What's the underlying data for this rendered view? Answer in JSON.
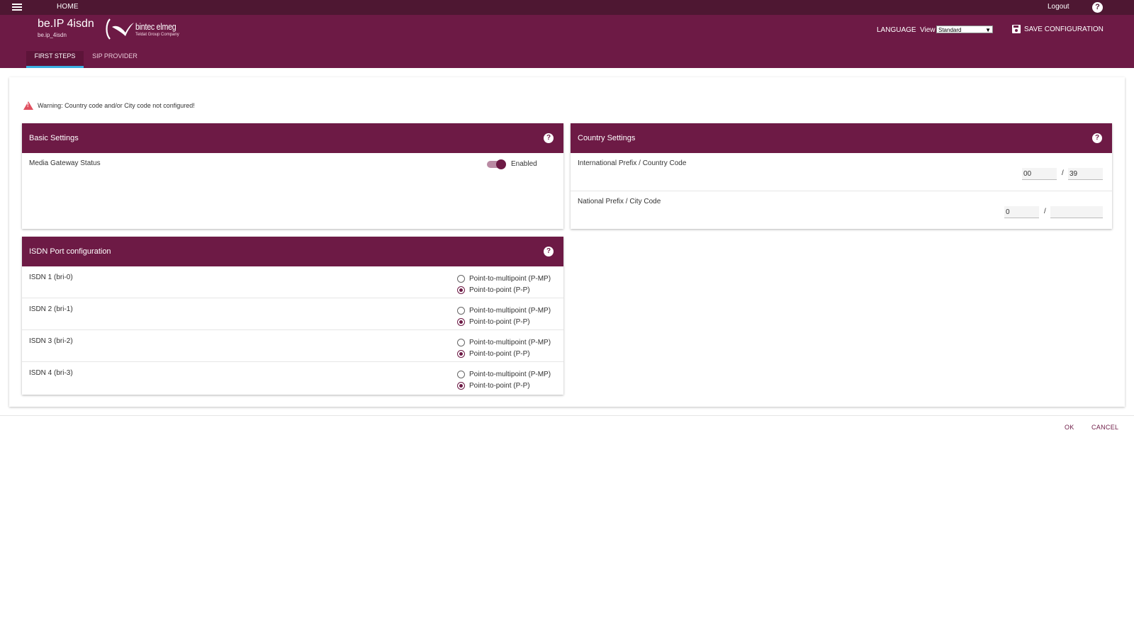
{
  "topbar": {
    "home": "HOME",
    "logout": "Logout",
    "help": "?"
  },
  "header": {
    "device_name": "be.IP 4isdn",
    "device_host": "be.ip_4isdn",
    "logo_brand": "bintec elmeg",
    "logo_sub": "Teldat Group Company",
    "language": "LANGUAGE",
    "view_label": "View",
    "view_value": "Standard",
    "save_config": "SAVE CONFIGURATION"
  },
  "tabs": [
    {
      "label": "FIRST STEPS",
      "active": true
    },
    {
      "label": "SIP PROVIDER",
      "active": false
    }
  ],
  "warning": "Warning: Country code and/or City code not configured!",
  "basic": {
    "title": "Basic Settings",
    "media_gateway_label": "Media Gateway Status",
    "media_gateway_state": "Enabled"
  },
  "country": {
    "title": "Country Settings",
    "intl_label": "International Prefix / Country Code",
    "intl_prefix": "00",
    "country_code": "39",
    "national_label": "National Prefix / City Code",
    "national_prefix": "0",
    "city_code": "",
    "slash": "/"
  },
  "isdn": {
    "title": "ISDN Port configuration",
    "option_pmp": "Point-to-multipoint (P-MP)",
    "option_pp": "Point-to-point (P-P)",
    "ports": [
      {
        "label": "ISDN 1 (bri-0)",
        "selected": "pp"
      },
      {
        "label": "ISDN 2 (bri-1)",
        "selected": "pp"
      },
      {
        "label": "ISDN 3 (bri-2)",
        "selected": "pp"
      },
      {
        "label": "ISDN 4 (bri-3)",
        "selected": "pp"
      }
    ]
  },
  "footer": {
    "ok": "OK",
    "cancel": "CANCEL"
  },
  "colors": {
    "topbar": "#4e1732",
    "header": "#6d1a45",
    "tab_indicator": "#3ab0e2",
    "warning": "#e05060"
  }
}
